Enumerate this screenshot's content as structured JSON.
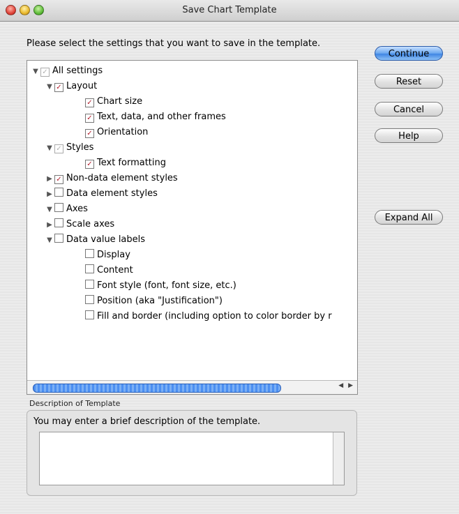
{
  "window": {
    "title": "Save Chart Template"
  },
  "prompt": "Please select the settings that you want to save in the template.",
  "tree": [
    {
      "label": "All settings",
      "depth": 0,
      "toggle": "expanded",
      "check": "dim"
    },
    {
      "label": "Layout",
      "depth": 1,
      "toggle": "expanded",
      "check": "checked"
    },
    {
      "label": "Chart size",
      "depth": 2,
      "toggle": "none",
      "check": "checked"
    },
    {
      "label": "Text, data, and other frames",
      "depth": 2,
      "toggle": "none",
      "check": "checked"
    },
    {
      "label": "Orientation",
      "depth": 2,
      "toggle": "none",
      "check": "checked"
    },
    {
      "label": "Styles",
      "depth": 1,
      "toggle": "expanded",
      "check": "dim"
    },
    {
      "label": "Text formatting",
      "depth": 2,
      "toggle": "none",
      "check": "checked"
    },
    {
      "label": "Non-data element styles",
      "depth": 1,
      "toggle": "collapsed",
      "check": "checked"
    },
    {
      "label": "Data element styles",
      "depth": 1,
      "toggle": "collapsed",
      "check": "unchecked"
    },
    {
      "label": "Axes",
      "depth": 1,
      "toggle": "expanded",
      "check": "unchecked"
    },
    {
      "label": "Scale axes",
      "depth": 1,
      "toggle": "collapsed",
      "check": "unchecked"
    },
    {
      "label": "Data value labels",
      "depth": 1,
      "toggle": "expanded",
      "check": "unchecked"
    },
    {
      "label": "Display",
      "depth": 2,
      "toggle": "none",
      "check": "unchecked"
    },
    {
      "label": "Content",
      "depth": 2,
      "toggle": "none",
      "check": "unchecked"
    },
    {
      "label": "Font style (font, font size, etc.)",
      "depth": 2,
      "toggle": "none",
      "check": "unchecked"
    },
    {
      "label": "Position (aka \"Justification\")",
      "depth": 2,
      "toggle": "none",
      "check": "unchecked"
    },
    {
      "label": "Fill and border (including option to color border by r",
      "depth": 2,
      "toggle": "none",
      "check": "unchecked"
    }
  ],
  "buttons": {
    "continue": "Continue",
    "reset": "Reset",
    "cancel": "Cancel",
    "help": "Help",
    "expand_all": "Expand All"
  },
  "description": {
    "caption": "Description of Template",
    "hint": "You may enter a brief description of the template.",
    "value": ""
  },
  "colors": {
    "check": "#b21a2a",
    "default_button": "#3f86e3"
  }
}
